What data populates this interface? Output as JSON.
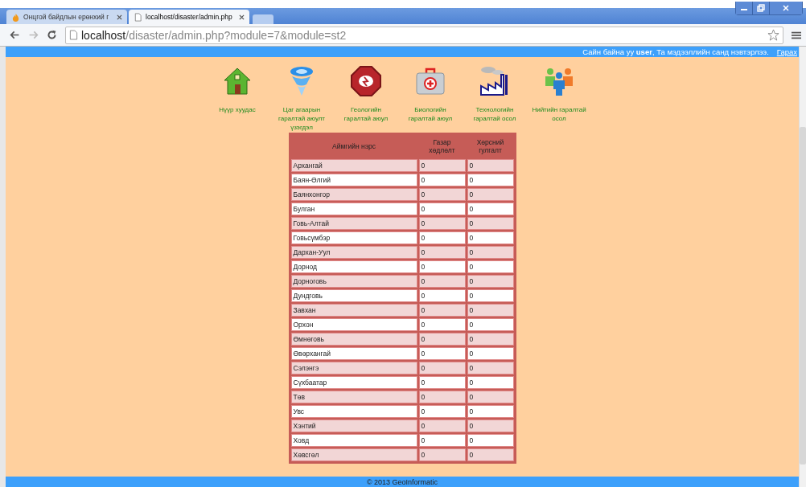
{
  "browser": {
    "tabs": [
      {
        "title": "Онцгой байдлын ерөнхий г",
        "selected": false
      },
      {
        "title": "localhost/disaster/admin.php",
        "selected": true
      }
    ],
    "address": {
      "host": "localhost",
      "path": "/disaster/admin.php?module=7&module=st2"
    }
  },
  "top_bar": {
    "greeting": "Сайн байна уу **user**, Та мэдээллийн санд нэвтэрлээ.",
    "logout": "Гарах"
  },
  "nav": [
    {
      "kind": "house",
      "label": "Нүүр хуудас"
    },
    {
      "kind": "tornado",
      "label": "Цаг агаарын гаралтай аюулт үзэгдэл"
    },
    {
      "kind": "stop",
      "label": "Геологийн гаралтай аюул"
    },
    {
      "kind": "medkit",
      "label": "Биологийн гаралтай аюул"
    },
    {
      "kind": "factory",
      "label": "Технологийн гаралтай осол"
    },
    {
      "kind": "people",
      "label": "Нийтийн гаралтай осол"
    }
  ],
  "table": {
    "columns": [
      "Аймгийн нэрс",
      "Газар хөдлөлт",
      "Хөрсний гулгалт"
    ],
    "rows": [
      [
        "Архангай",
        "0",
        "0"
      ],
      [
        "Баян-Өлгий",
        "0",
        "0"
      ],
      [
        "Баянхонгор",
        "0",
        "0"
      ],
      [
        "Булган",
        "0",
        "0"
      ],
      [
        "Говь-Алтай",
        "0",
        "0"
      ],
      [
        "Говьсүмбэр",
        "0",
        "0"
      ],
      [
        "Дархан-Уул",
        "0",
        "0"
      ],
      [
        "Дорнод",
        "0",
        "0"
      ],
      [
        "Дорноговь",
        "0",
        "0"
      ],
      [
        "Дундговь",
        "0",
        "0"
      ],
      [
        "Завхан",
        "0",
        "0"
      ],
      [
        "Орхон",
        "0",
        "0"
      ],
      [
        "Өмнөговь",
        "0",
        "0"
      ],
      [
        "Өвөрхангай",
        "0",
        "0"
      ],
      [
        "Сэлэнгэ",
        "0",
        "0"
      ],
      [
        "Сүхбаатар",
        "0",
        "0"
      ],
      [
        "Төв",
        "0",
        "0"
      ],
      [
        "Увс",
        "0",
        "0"
      ],
      [
        "Хэнтий",
        "0",
        "0"
      ],
      [
        "Ховд",
        "0",
        "0"
      ],
      [
        "Хөвсгөл",
        "0",
        "0"
      ]
    ]
  },
  "footer": "© 2013 GeoInformatic"
}
